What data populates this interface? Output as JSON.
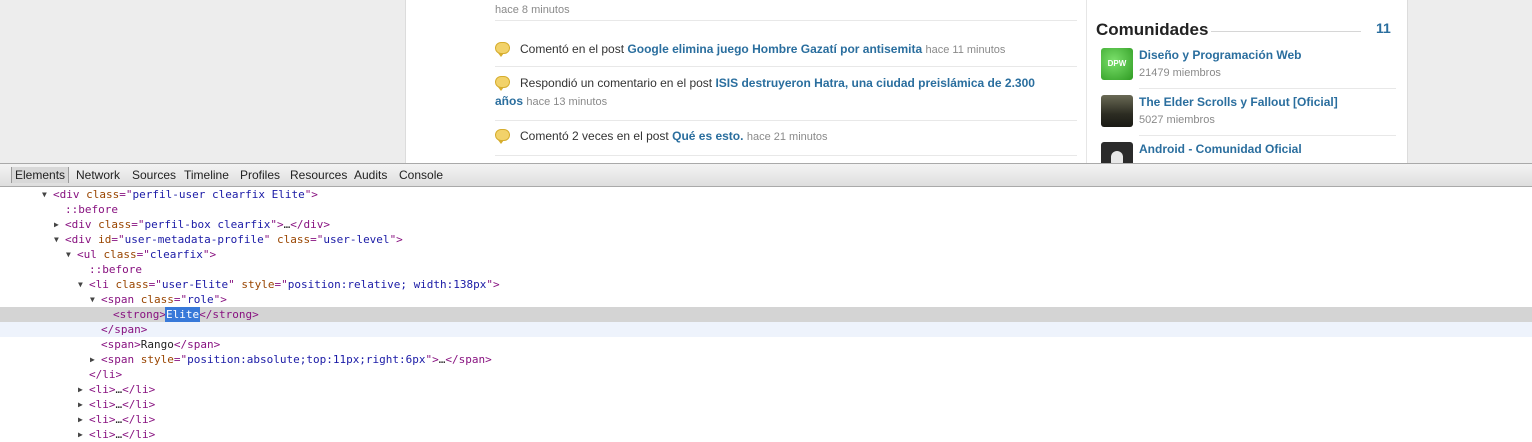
{
  "activity": [
    {
      "prefix": "",
      "link": "",
      "time": "hace 8 minutos"
    },
    {
      "prefix": "Comentó en el post",
      "link": "Google elimina juego Hombre Gazatí por antisemita",
      "time": "hace 11 minutos"
    },
    {
      "prefix": "Respondió un comentario en el post",
      "link": "ISIS destruyeron Hatra, una ciudad preislámica de 2.300",
      "link2": "años",
      "time": "hace 13 minutos"
    },
    {
      "prefix": "Comentó 2 veces en el post",
      "link": "Qué es esto.",
      "time": "hace 21 minutos"
    }
  ],
  "comunidades": {
    "title": "Comunidades",
    "count": "11",
    "items": [
      {
        "name": "Diseño y Programación Web",
        "members": "21479 miembros",
        "thumb_label": "DPW"
      },
      {
        "name": "The Elder Scrolls y Fallout [Oficial]",
        "members": "5027 miembros"
      },
      {
        "name": "Android - Comunidad Oficial",
        "members": ""
      }
    ]
  },
  "devtools": {
    "tabs": [
      "Elements",
      "Network",
      "Sources",
      "Timeline",
      "Profiles",
      "Resources",
      "Audits",
      "Console"
    ],
    "active_tab": "Elements"
  },
  "dom_lines": [
    {
      "tri": "open",
      "html": "<span class=\"t\">&lt;div </span><span class=\"an\">class</span><span class=\"t\">=\"</span><span class=\"av\">perfil-user clearfix Elite</span><span class=\"t\">\"&gt;</span>"
    },
    {
      "tri": "",
      "html": "<span class=\"ps\">::before</span>"
    },
    {
      "tri": "closed",
      "html": "<span class=\"t\">&lt;div </span><span class=\"an\">class</span><span class=\"t\">=\"</span><span class=\"av\">perfil-box clearfix</span><span class=\"t\">\"&gt;</span>…<span class=\"t\">&lt;/div&gt;</span>"
    },
    {
      "tri": "open",
      "html": "<span class=\"t\">&lt;div </span><span class=\"an\">id</span><span class=\"t\">=\"</span><span class=\"av\">user-metadata-profile</span><span class=\"t\">\" </span><span class=\"an\">class</span><span class=\"t\">=\"</span><span class=\"av\">user-level</span><span class=\"t\">\"&gt;</span>"
    },
    {
      "tri": "open",
      "html": "<span class=\"t\">&lt;ul </span><span class=\"an\">class</span><span class=\"t\">=\"</span><span class=\"av\">clearfix</span><span class=\"t\">\"&gt;</span>"
    },
    {
      "tri": "",
      "html": "<span class=\"ps\">::before</span>"
    },
    {
      "tri": "open",
      "html": "<span class=\"t\">&lt;li </span><span class=\"an\">class</span><span class=\"t\">=\"</span><span class=\"av\">user-Elite</span><span class=\"t\">\" </span><span class=\"an\">style</span><span class=\"t\">=\"</span><span class=\"av\">position:relative; width:138px</span><span class=\"t\">\"&gt;</span>"
    },
    {
      "tri": "open",
      "html": "<span class=\"t\">&lt;span </span><span class=\"an\">class</span><span class=\"t\">=\"</span><span class=\"av\">role</span><span class=\"t\">\"&gt;</span>"
    },
    {
      "tri": "",
      "sel": true,
      "html": "<span class=\"t\">&lt;strong&gt;</span><span class=\"hl\">Elite</span><span class=\"t\">&lt;/strong&gt;</span>"
    },
    {
      "tri": "",
      "hov": true,
      "html": "<span class=\"t\">&lt;/span&gt;</span>"
    },
    {
      "tri": "",
      "html": "<span class=\"t\">&lt;span&gt;</span>Rango<span class=\"t\">&lt;/span&gt;</span>"
    },
    {
      "tri": "closed",
      "html": "<span class=\"t\">&lt;span </span><span class=\"an\">style</span><span class=\"t\">=\"</span><span class=\"av\">position:absolute;top:11px;right:6px</span><span class=\"t\">\"&gt;</span>…<span class=\"t\">&lt;/span&gt;</span>"
    },
    {
      "tri": "",
      "html": "<span class=\"t\">&lt;/li&gt;</span>"
    },
    {
      "tri": "closed",
      "html": "<span class=\"t\">&lt;li&gt;</span>…<span class=\"t\">&lt;/li&gt;</span>"
    },
    {
      "tri": "closed",
      "html": "<span class=\"t\">&lt;li&gt;</span>…<span class=\"t\">&lt;/li&gt;</span>"
    },
    {
      "tri": "closed",
      "html": "<span class=\"t\">&lt;li&gt;</span>…<span class=\"t\">&lt;/li&gt;</span>"
    },
    {
      "tri": "closed",
      "html": "<span class=\"t\">&lt;li&gt;</span>…<span class=\"t\">&lt;/li&gt;</span>"
    }
  ]
}
